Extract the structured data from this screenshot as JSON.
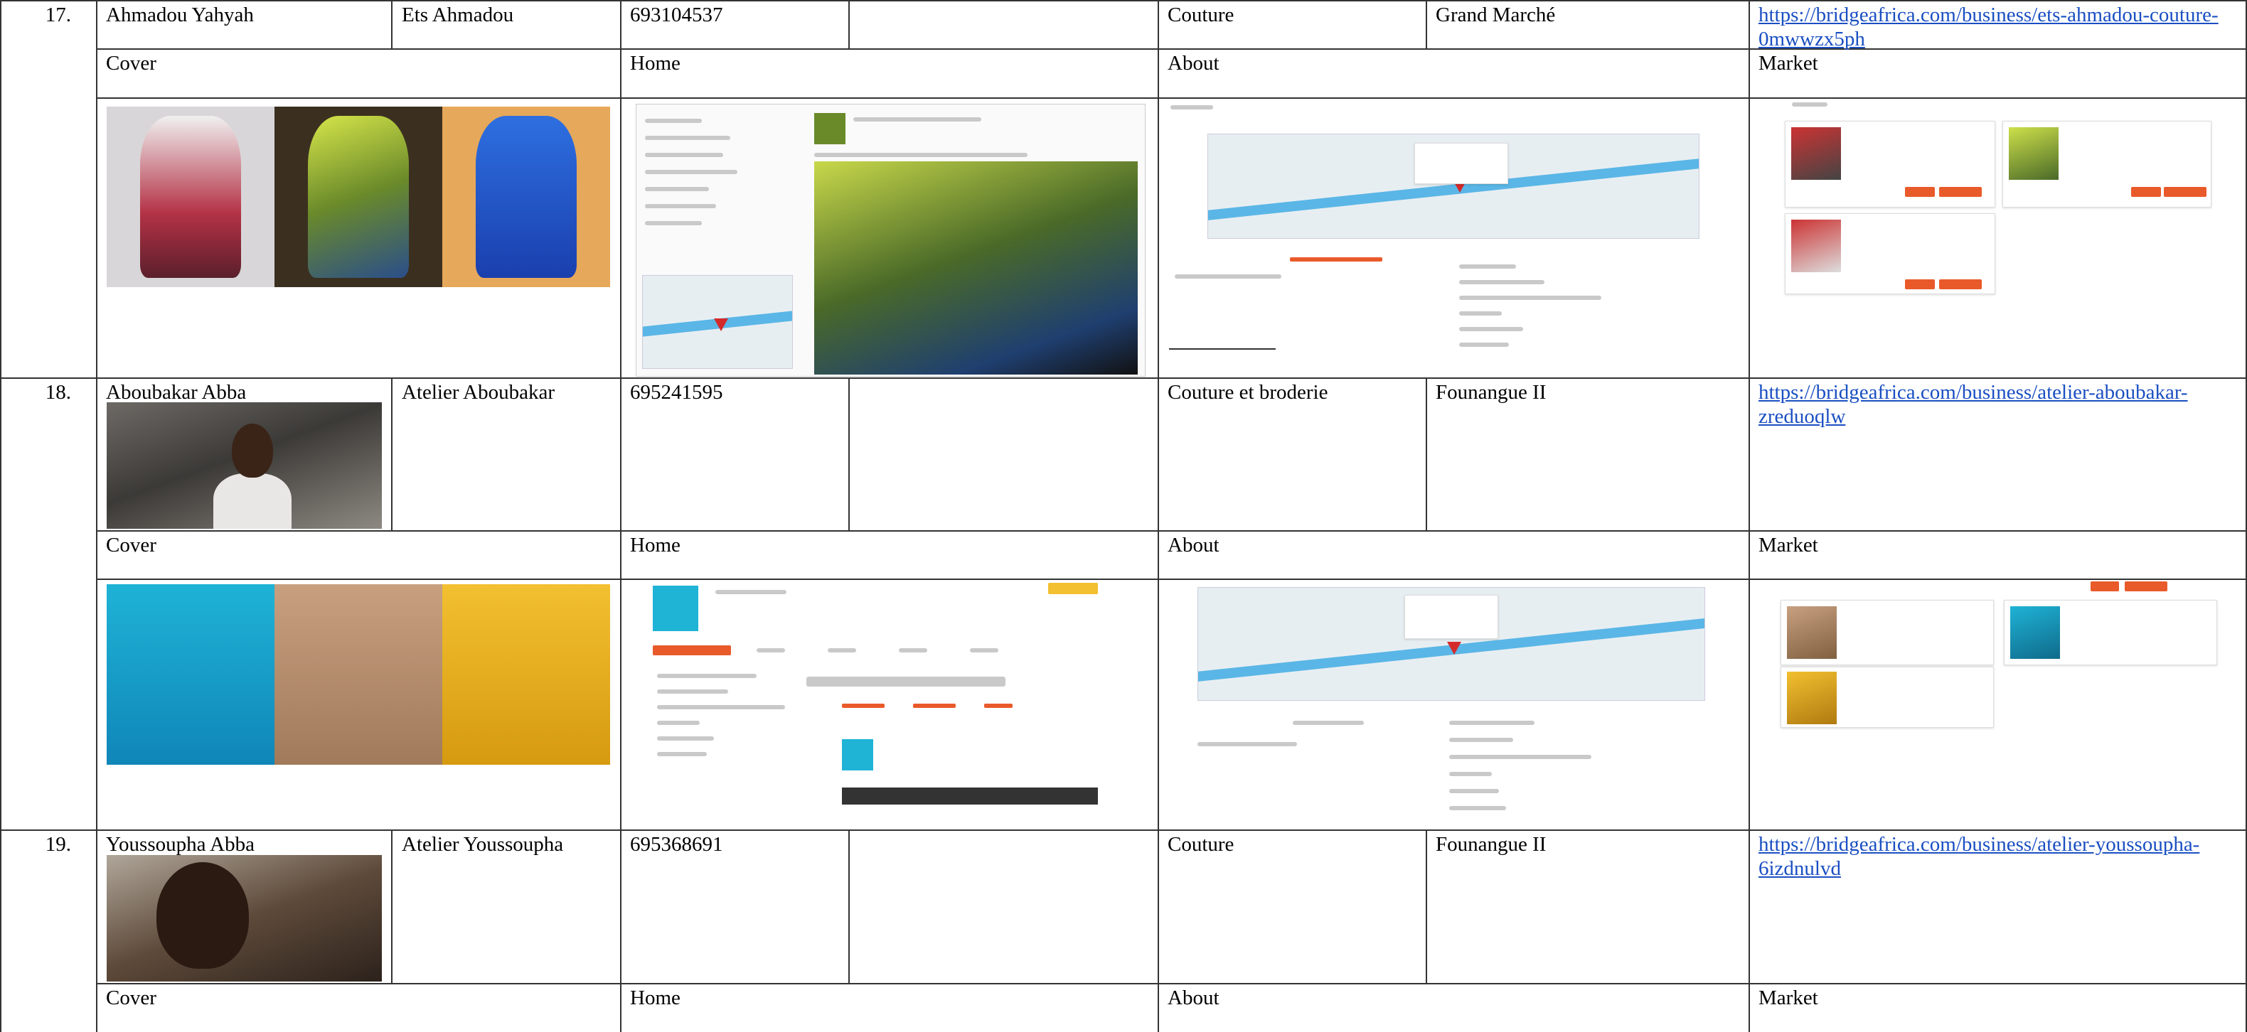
{
  "rows": [
    {
      "num": "17.",
      "name": "Ahmadou Yahyah",
      "business": "Ets Ahmadou",
      "phone": "693104537",
      "activity": "Couture",
      "location": "Grand Marché",
      "url": "https://bridgeafrica.com/business/ets-ahmadou-couture-0mwwzx5ph"
    },
    {
      "num": "18.",
      "name": "Aboubakar Abba",
      "business": "Atelier Aboubakar",
      "phone": "695241595",
      "activity": "Couture et broderie",
      "location": "Founangue II",
      "url": "https://bridgeafrica.com/business/atelier-aboubakar-zreduoqlw"
    },
    {
      "num": "19.",
      "name": "Youssoupha Abba",
      "business": "Atelier Youssoupha",
      "phone": "695368691",
      "activity": "Couture",
      "location": "Founangue II",
      "url": "https://bridgeafrica.com/business/atelier-youssoupha-6izdnulvd"
    }
  ],
  "sections": {
    "cover": "Cover",
    "home": "Home",
    "about": "About",
    "market": "Market"
  }
}
